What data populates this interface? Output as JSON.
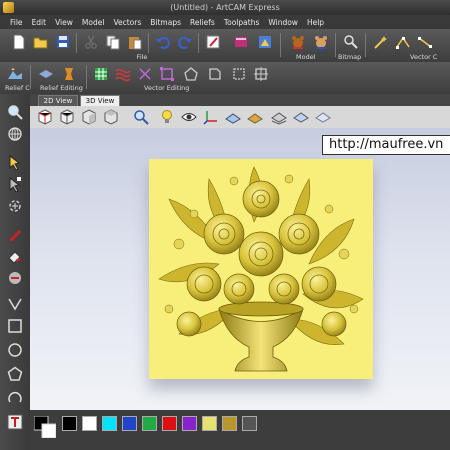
{
  "window": {
    "title": "(Untitled) - ArtCAM Express"
  },
  "menu": [
    "File",
    "Edit",
    "View",
    "Model",
    "Vectors",
    "Bitmaps",
    "Reliefs",
    "Toolpaths",
    "Window",
    "Help"
  ],
  "toolbar_groups": {
    "file": "File",
    "model": "Model",
    "bitmap": "Bitmap",
    "vector_create": "Vector C",
    "relief_create": "Relief C",
    "relief_editing": "Relief Editing",
    "vector_editing": "Vector Editing"
  },
  "view_tabs": [
    {
      "label": "2D View",
      "active": false
    },
    {
      "label": "3D View",
      "active": true
    }
  ],
  "watermark": "http://maufree.vn",
  "colors": {
    "relief_base": "#f8ef7a",
    "relief_gold": "#d6c23a",
    "viewport_top": "#c7cde0"
  },
  "palette": [
    "#000000",
    "#ffffff",
    "#00e5ff",
    "#2244cc",
    "#22aa44",
    "#dd1111",
    "#8822cc",
    "#e8e070",
    "#b8962e",
    "#555555"
  ],
  "icons": {
    "toolbar_1": [
      "new-icon",
      "open-icon",
      "save-icon",
      "cut-icon",
      "copy-icon",
      "paste-icon",
      "undo-icon",
      "redo-icon",
      "edit-icon",
      "book-icon",
      "model-icon",
      "bear-icon",
      "bear-outline-icon",
      "bitmap-tool-icon",
      "wand-icon",
      "vector-nodes-icon",
      "vector-line-icon"
    ],
    "left_toolbar": [
      "zoom-icon",
      "globe-icon",
      "select-arrow-icon",
      "node-edit-icon",
      "transform-icon",
      "pen-icon",
      "paint-icon",
      "fill-icon",
      "shape-icon",
      "rectangle-icon",
      "circle-icon",
      "polygon-icon",
      "arc-icon",
      "text-icon"
    ]
  }
}
